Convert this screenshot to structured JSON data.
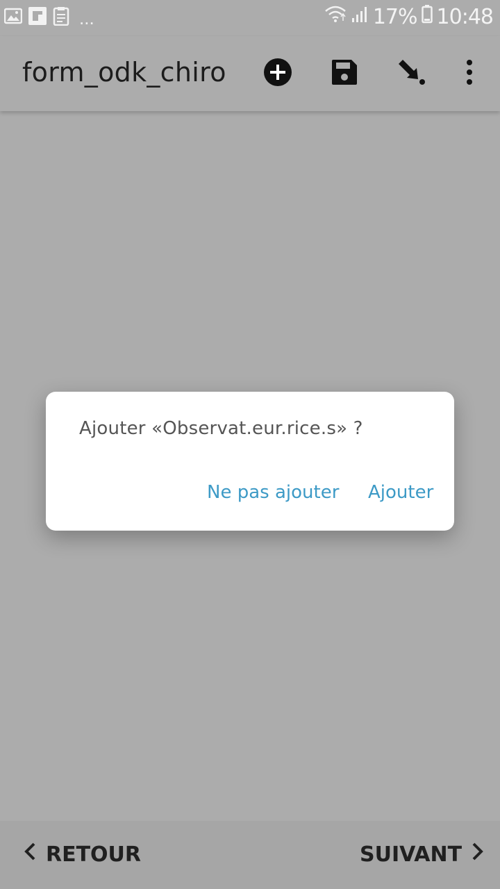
{
  "status_bar": {
    "overflow_indicator": "...",
    "battery_percent": "17%",
    "time": "10:48",
    "left_icons": [
      "gallery-icon",
      "flipboard-icon",
      "clipboard-icon"
    ],
    "right_icons": [
      "wifi-icon",
      "signal-icon",
      "battery-icon"
    ]
  },
  "app_bar": {
    "title": "form_odk_chiro",
    "actions": [
      "add-circle-icon",
      "save-icon",
      "jump-to-icon",
      "more-vert-icon"
    ]
  },
  "dialog": {
    "message": "Ajouter «Observat.eur.rice.s» ?",
    "cancel_label": "Ne pas ajouter",
    "confirm_label": "Ajouter"
  },
  "bottom_nav": {
    "back_label": "RETOUR",
    "next_label": "SUIVANT"
  },
  "colors": {
    "scrim": "#acacac",
    "accent": "#3d9ac6",
    "dialog_background": "#ffffff",
    "title_text": "#1c1c1c"
  }
}
